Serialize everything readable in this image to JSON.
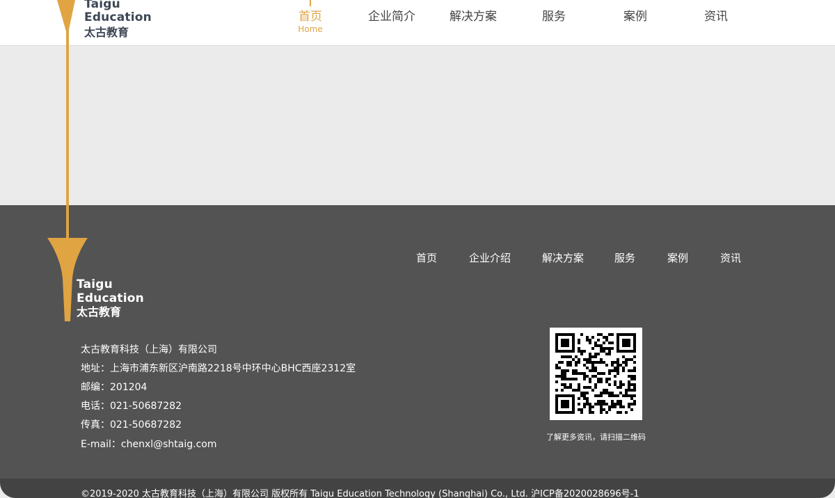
{
  "header": {
    "brand_en_line1": "Taigu",
    "brand_en_line2": "Education",
    "brand_cn": "太古教育",
    "nav": [
      {
        "label": "首页",
        "sub": "Home"
      },
      {
        "label": "企业简介"
      },
      {
        "label": "解决方案"
      },
      {
        "label": "服务"
      },
      {
        "label": "案例"
      },
      {
        "label": "资讯"
      }
    ]
  },
  "footer": {
    "brand_en_line1": "Taigu",
    "brand_en_line2": "Education",
    "brand_cn": "太古教育",
    "nav": [
      "首页",
      "企业介绍",
      "解决方案",
      "服务",
      "案例",
      "资讯"
    ],
    "company": "太古教育科技（上海）有限公司",
    "address": "地址：上海市浦东新区沪南路2218号中环中心BHC西座2312室",
    "postcode": "邮编：201204",
    "phone": "电话：021-50687282",
    "fax": "传真：021-50687282",
    "email": "E-mail：chenxl@shtaig.com",
    "qr_caption": "了解更多资讯，请扫描二维码",
    "copyright": "©2019-2020 太古教育科技（上海）有限公司 版权所有 Taigu Education Technology (Shanghai) Co., Ltd. 沪ICP备2020028696号-1"
  },
  "colors": {
    "accent": "#e0a443",
    "footer_bg": "#535353",
    "bottom_bar_bg": "#434343",
    "content_bg": "#ebebeb",
    "brand_text": "#3c4654"
  },
  "icons": [
    "brand-arrow-icon",
    "qr-code-icon"
  ]
}
